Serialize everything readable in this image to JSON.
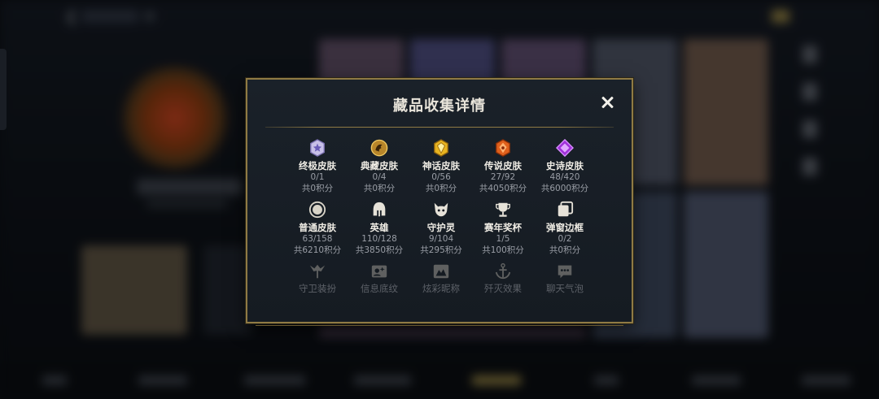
{
  "modal": {
    "title": "藏品收集详情",
    "row1": [
      {
        "label": "终极皮肤",
        "count": "0/1",
        "points": "共0积分",
        "icon": "ultimate-skin-icon"
      },
      {
        "label": "典藏皮肤",
        "count": "0/4",
        "points": "共0积分",
        "icon": "collector-skin-icon"
      },
      {
        "label": "神话皮肤",
        "count": "0/56",
        "points": "共0积分",
        "icon": "mythic-skin-icon"
      },
      {
        "label": "传说皮肤",
        "count": "27/92",
        "points": "共4050积分",
        "icon": "legendary-skin-icon"
      },
      {
        "label": "史诗皮肤",
        "count": "48/420",
        "points": "共6000积分",
        "icon": "epic-skin-icon"
      }
    ],
    "row2": [
      {
        "label": "普通皮肤",
        "count": "63/158",
        "points": "共6210积分",
        "icon": "normal-skin-icon"
      },
      {
        "label": "英雄",
        "count": "110/128",
        "points": "共3850积分",
        "icon": "hero-helmet-icon"
      },
      {
        "label": "守护灵",
        "count": "9/104",
        "points": "共295积分",
        "icon": "guardian-spirit-icon"
      },
      {
        "label": "赛年奖杯",
        "count": "1/5",
        "points": "共100积分",
        "icon": "trophy-icon"
      },
      {
        "label": "弹窗边框",
        "count": "0/2",
        "points": "共0积分",
        "icon": "frame-icon"
      }
    ],
    "row3": [
      {
        "label": "守卫装扮",
        "icon": "ward-skin-icon"
      },
      {
        "label": "信息底纹",
        "icon": "info-background-icon"
      },
      {
        "label": "炫彩昵称",
        "icon": "colorful-nickname-icon"
      },
      {
        "label": "歼灭效果",
        "icon": "annihilation-effect-icon"
      },
      {
        "label": "聊天气泡",
        "icon": "chat-bubble-icon"
      }
    ]
  },
  "colors": {
    "border_gold": "#8f7a44",
    "panel_bg": "#1a2129",
    "label_text": "#f0ede5",
    "sub_text": "#9a9ea6",
    "faded_text": "#5e6269"
  }
}
